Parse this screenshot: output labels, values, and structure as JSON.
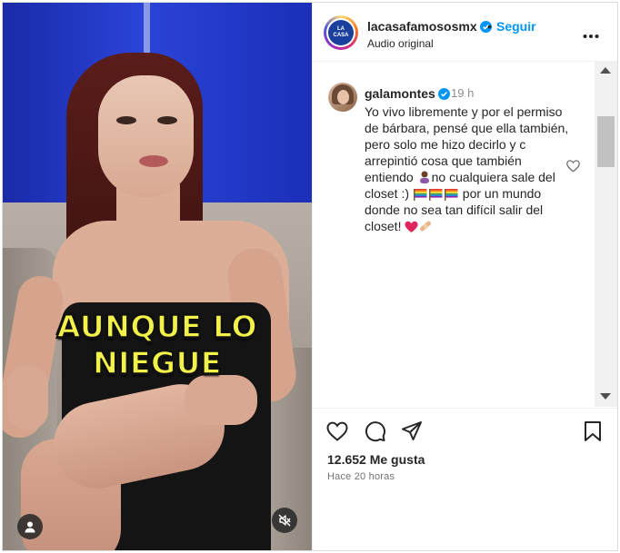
{
  "video": {
    "caption_line1": "AUNQUE LO",
    "caption_line2": "NIEGUE",
    "user_icon": "user-icon",
    "mute_icon": "muted-speaker-icon"
  },
  "post_header": {
    "username": "lacasafamososmx",
    "verified_icon": "verified-badge-icon",
    "separator": "•",
    "follow_label": "Seguir",
    "audio": "Audio original",
    "more_icon": "more-options-icon",
    "avatar_logo_text": "LA CASA FAMOSOS"
  },
  "comment": {
    "username": "galamontes",
    "time": "19 h",
    "text_part1": "Yo vivo libremente y por el permiso de bárbara, pensé que ella también, pero solo me hizo decirlo y c arrepintió cosa que también entiendo ",
    "text_part2": "no cualquiera sale del closet :) ",
    "text_part3": " por un mundo donde no sea tan difícil salir del closet! ",
    "heart_icon": "heart-outline-icon"
  },
  "actions": {
    "like_icon": "heart-outline-icon",
    "comment_icon": "comment-bubble-icon",
    "share_icon": "paper-plane-icon",
    "save_icon": "bookmark-icon",
    "likes": "12.652 Me gusta",
    "posted_ago": "Hace 20 horas"
  },
  "colors": {
    "link_blue": "#0095f6",
    "verified_blue": "#0095f6",
    "caption_yellow": "#f2f24a",
    "text": "#262626",
    "muted": "#8e8e8e"
  }
}
